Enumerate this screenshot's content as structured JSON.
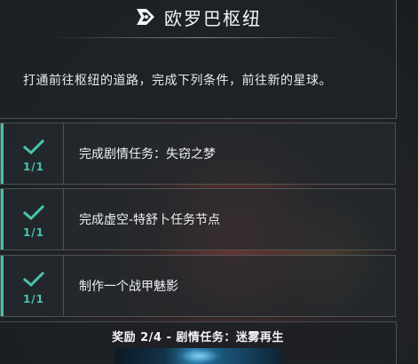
{
  "header": {
    "title": "欧罗巴枢纽",
    "icon": "relay-node-icon"
  },
  "description": "打通前往枢纽的道路，完成下列条件，前往新的星球。",
  "tasks": [
    {
      "progress": "1/1",
      "label": "完成剧情任务：失窃之梦",
      "completed": true
    },
    {
      "progress": "1/1",
      "label": "完成虚空-特舒卜任务节点",
      "completed": true
    },
    {
      "progress": "1/1",
      "label": "制作一个战甲魅影",
      "completed": true
    }
  ],
  "reward": {
    "title": "奖励 2/4 - 剧情任务：迷雾再生",
    "image": "quest-reward-thumbnail"
  },
  "colors": {
    "accent": "#44c2aa",
    "panel": "#1c2226",
    "text": "#eef1f2"
  }
}
